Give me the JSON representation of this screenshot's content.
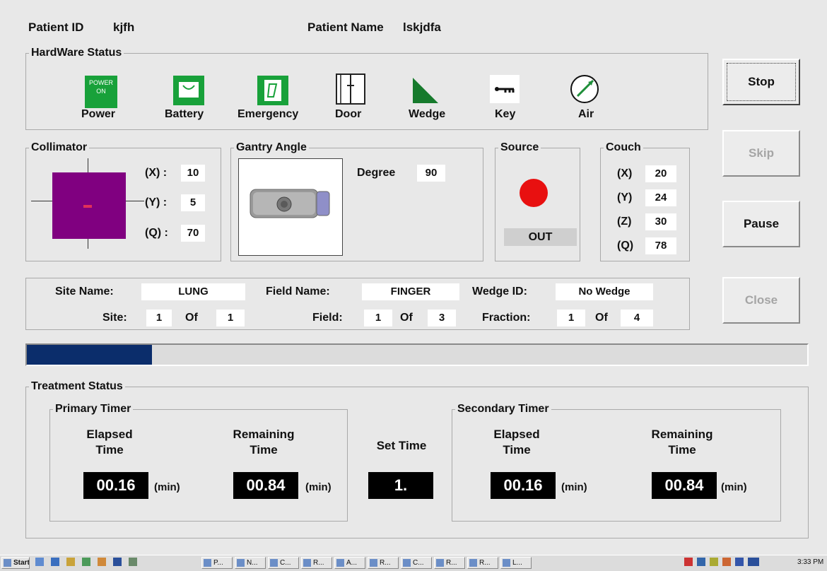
{
  "header": {
    "patient_id_label": "Patient ID",
    "patient_id": "kjfh",
    "patient_name_label": "Patient Name",
    "patient_name": "lskjdfa"
  },
  "hardware": {
    "title": "HardWare Status",
    "items": [
      {
        "label": "Power",
        "icon": "power-icon",
        "icon_text": "POWER ON"
      },
      {
        "label": "Battery",
        "icon": "battery-icon"
      },
      {
        "label": "Emergency",
        "icon": "emergency-icon"
      },
      {
        "label": "Door",
        "icon": "door-icon"
      },
      {
        "label": "Wedge",
        "icon": "wedge-icon"
      },
      {
        "label": "Key",
        "icon": "key-icon"
      },
      {
        "label": "Air",
        "icon": "air-gauge-icon"
      }
    ]
  },
  "collimator": {
    "title": "Collimator",
    "x_label": "(X) :",
    "x": "10",
    "y_label": "(Y) :",
    "y": "5",
    "q_label": "(Q) :",
    "q": "70",
    "color": "#800080"
  },
  "gantry": {
    "title": "Gantry Angle",
    "degree_label": "Degree",
    "degree": "90"
  },
  "source": {
    "title": "Source",
    "status": "OUT",
    "indicator_color": "#e81010"
  },
  "couch": {
    "title": "Couch",
    "x_label": "(X)",
    "x": "20",
    "y_label": "(Y)",
    "y": "24",
    "z_label": "(Z)",
    "z": "30",
    "q_label": "(Q)",
    "q": "78"
  },
  "info": {
    "site_name_label": "Site Name:",
    "site_name": "LUNG",
    "field_name_label": "Field Name:",
    "field_name": "FINGER",
    "wedge_id_label": "Wedge ID:",
    "wedge_id": "No Wedge",
    "site_label": "Site:",
    "site": "1",
    "site_of": "Of",
    "site_total": "1",
    "field_label": "Field:",
    "field": "1",
    "field_of": "Of",
    "field_total": "3",
    "fraction_label": "Fraction:",
    "fraction": "1",
    "fraction_of": "Of",
    "fraction_total": "4"
  },
  "progress": {
    "fraction": 0.16,
    "color": "#0b2d6b"
  },
  "treatment": {
    "title": "Treatment Status",
    "primary": {
      "title": "Primary Timer",
      "elapsed_label_1": "Elapsed",
      "elapsed_label_2": "Time",
      "remaining_label_1": "Remaining",
      "remaining_label_2": "Time",
      "elapsed": "00.16",
      "remaining": "00.84",
      "unit": "(min)"
    },
    "set_time_label": "Set Time",
    "set_time": "1.",
    "secondary": {
      "title": "Secondary Timer",
      "elapsed_label_1": "Elapsed",
      "elapsed_label_2": "Time",
      "remaining_label_1": "Remaining",
      "remaining_label_2": "Time",
      "elapsed": "00.16",
      "remaining": "00.84",
      "unit": "(min)"
    }
  },
  "buttons": {
    "stop": "Stop",
    "skip": "Skip",
    "pause": "Pause",
    "close": "Close"
  },
  "taskbar": {
    "start": "Start",
    "items": [
      "P...",
      "N...",
      "C...",
      "R...",
      "A...",
      "R...",
      "C...",
      "R...",
      "R...",
      "L..."
    ],
    "time": "3:33 PM"
  }
}
